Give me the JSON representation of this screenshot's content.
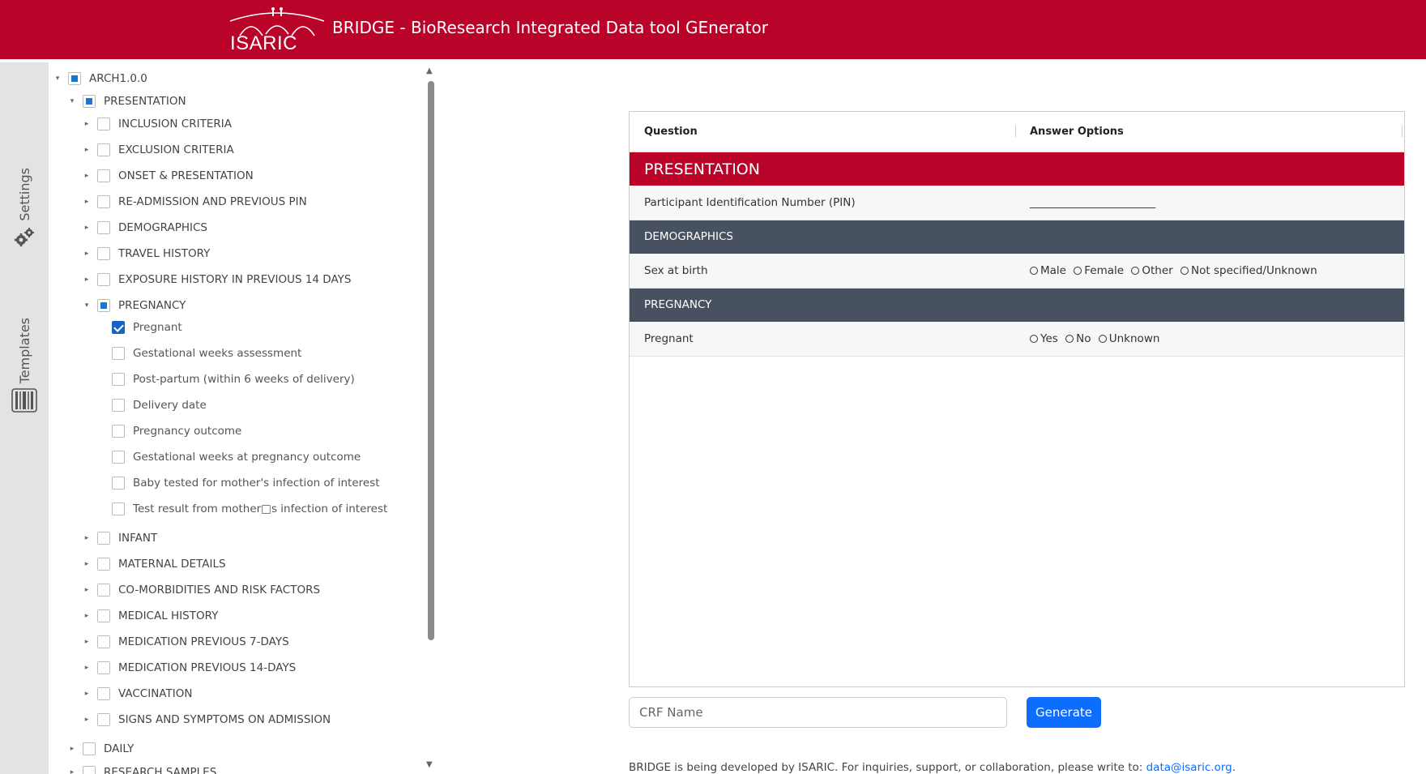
{
  "header": {
    "logo_text": "ISARIC",
    "title": "BRIDGE - BioResearch Integrated Data tool GEnerator"
  },
  "rail": {
    "settings_label": "Settings",
    "templates_label": "Templates"
  },
  "tree": {
    "root": {
      "label": "ARCH1.0.0",
      "state": "partial"
    },
    "presentation": {
      "label": "PRESENTATION",
      "state": "partial"
    },
    "sections": [
      {
        "label": "INCLUSION CRITERIA",
        "state": "unchecked"
      },
      {
        "label": "EXCLUSION CRITERIA",
        "state": "unchecked"
      },
      {
        "label": "ONSET & PRESENTATION",
        "state": "unchecked"
      },
      {
        "label": "RE-ADMISSION AND PREVIOUS PIN",
        "state": "unchecked"
      },
      {
        "label": "DEMOGRAPHICS",
        "state": "unchecked"
      },
      {
        "label": "TRAVEL HISTORY",
        "state": "unchecked"
      },
      {
        "label": "EXPOSURE HISTORY IN PREVIOUS 14 DAYS",
        "state": "unchecked"
      },
      {
        "label": "PREGNANCY",
        "state": "partial"
      }
    ],
    "pregnancy_items": [
      {
        "label": "Pregnant",
        "state": "checked"
      },
      {
        "label": "Gestational weeks assessment",
        "state": "unchecked"
      },
      {
        "label": "Post-partum (within 6 weeks of delivery)",
        "state": "unchecked"
      },
      {
        "label": "Delivery date",
        "state": "unchecked"
      },
      {
        "label": "Pregnancy outcome",
        "state": "unchecked"
      },
      {
        "label": "Gestational weeks at pregnancy outcome",
        "state": "unchecked"
      },
      {
        "label": "Baby tested for mother's infection of interest",
        "state": "unchecked"
      },
      {
        "label": "Test result from mother□s infection of interest",
        "state": "unchecked"
      }
    ],
    "sections_after": [
      {
        "label": "INFANT",
        "state": "unchecked"
      },
      {
        "label": "MATERNAL DETAILS",
        "state": "unchecked"
      },
      {
        "label": "CO-MORBIDITIES AND RISK FACTORS",
        "state": "unchecked"
      },
      {
        "label": "MEDICAL HISTORY",
        "state": "unchecked"
      },
      {
        "label": "MEDICATION PREVIOUS 7-DAYS",
        "state": "unchecked"
      },
      {
        "label": "MEDICATION PREVIOUS 14-DAYS",
        "state": "unchecked"
      },
      {
        "label": "VACCINATION",
        "state": "unchecked"
      },
      {
        "label": "SIGNS AND SYMPTOMS ON ADMISSION",
        "state": "unchecked"
      }
    ],
    "daily": {
      "label": "DAILY",
      "state": "unchecked"
    },
    "research_samples": {
      "label": "RESEARCH SAMPLES",
      "state": "unchecked"
    }
  },
  "table": {
    "col_question": "Question",
    "col_answers": "Answer Options",
    "rows": [
      {
        "kind": "section",
        "question": "PRESENTATION"
      },
      {
        "kind": "question",
        "question": "Participant Identification Number (PIN)",
        "answer": "_______________________"
      },
      {
        "kind": "subsection",
        "question": "DEMOGRAPHICS"
      },
      {
        "kind": "question",
        "question": "Sex at birth",
        "options": [
          "Male",
          "Female",
          "Other",
          "Not specified/Unknown"
        ]
      },
      {
        "kind": "subsection",
        "question": "PREGNANCY"
      },
      {
        "kind": "question",
        "question": "Pregnant",
        "options": [
          "Yes",
          "No",
          "Unknown"
        ]
      }
    ]
  },
  "form": {
    "crf_placeholder": "CRF Name",
    "crf_value": "",
    "generate_label": "Generate"
  },
  "footer": {
    "text": "BRIDGE is being developed by ISARIC. For inquiries, support, or collaboration, please write to: ",
    "email": "data@isaric.org",
    "suffix": "."
  },
  "colors": {
    "brand_red": "#BA0329",
    "section_dark": "#485160",
    "primary_blue": "#0D6EFD"
  }
}
